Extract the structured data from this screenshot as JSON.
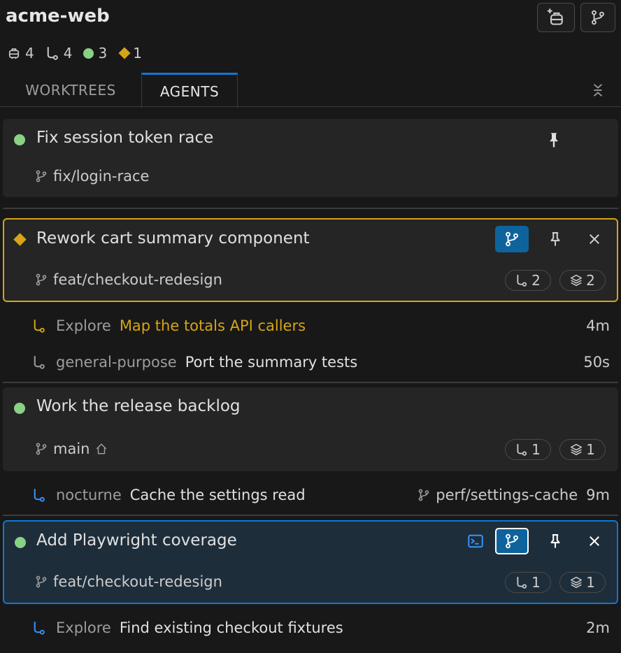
{
  "header": {
    "title": "acme-web",
    "stats": {
      "agents": "4",
      "subagents": "4",
      "running": "3",
      "attention": "1"
    }
  },
  "tabs": [
    {
      "label": "WORKTREES",
      "active": false
    },
    {
      "label": "AGENTS",
      "active": true
    }
  ],
  "colors": {
    "accent": "#0e78d4",
    "running": "#89d185",
    "attention": "#d4a517"
  },
  "agents": [
    {
      "title": "Fix session token race",
      "status": "running",
      "branch": "fix/login-race",
      "pinned": true
    },
    {
      "title": "Rework cart summary component",
      "status": "attention",
      "branch": "feat/checkout-redesign",
      "subagents_count": "2",
      "stack_count": "2",
      "subagents": [
        {
          "type": "Explore",
          "task": "Map the totals API callers",
          "time": "4m"
        },
        {
          "type": "general-purpose",
          "task": "Port the summary tests",
          "time": "50s"
        }
      ]
    },
    {
      "title": "Work the release backlog",
      "status": "running",
      "branch": "main",
      "subagents_count": "1",
      "stack_count": "1",
      "subagents": [
        {
          "type": "nocturne",
          "task": "Cache the settings read",
          "branch": "perf/settings-cache",
          "time": "9m"
        }
      ]
    },
    {
      "title": "Add Playwright coverage",
      "status": "running",
      "branch": "feat/checkout-redesign",
      "subagents_count": "1",
      "stack_count": "1",
      "subagents": [
        {
          "type": "Explore",
          "task": "Find existing checkout fixtures",
          "time": "2m"
        }
      ]
    }
  ]
}
